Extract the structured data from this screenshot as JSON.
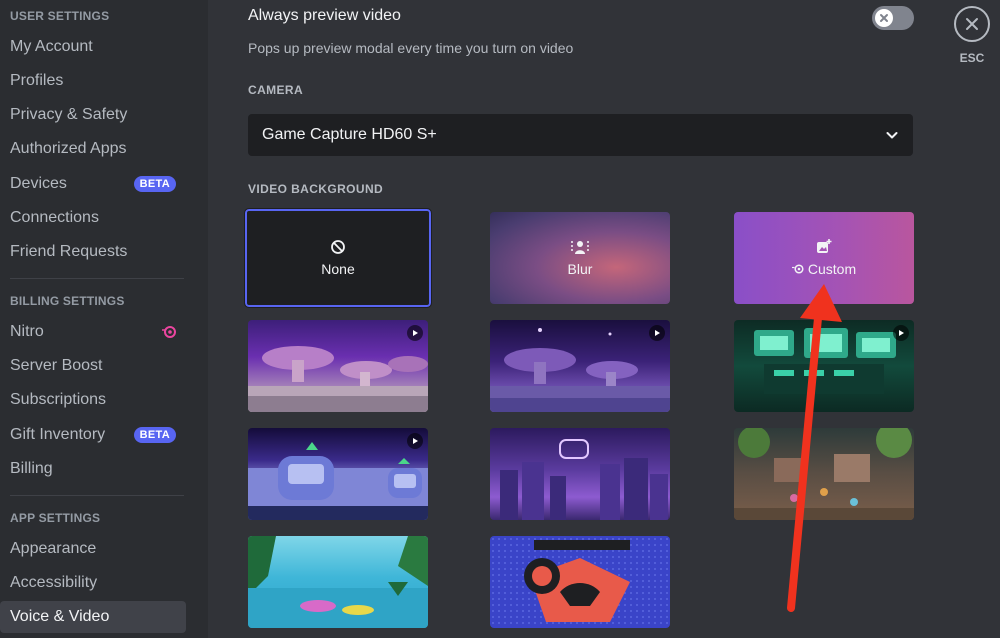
{
  "sidebar": {
    "user_settings_head": "User Settings",
    "user_items": [
      "My Account",
      "Profiles",
      "Privacy & Safety",
      "Authorized Apps",
      "Devices",
      "Connections",
      "Friend Requests"
    ],
    "devices_badge": "BETA",
    "billing_head": "Billing Settings",
    "billing_items": [
      "Nitro",
      "Server Boost",
      "Subscriptions",
      "Gift Inventory",
      "Billing"
    ],
    "gift_badge": "BETA",
    "app_head": "App Settings",
    "app_items": [
      "Appearance",
      "Accessibility",
      "Voice & Video"
    ],
    "active_item": "Voice & Video"
  },
  "preview": {
    "title": "Always preview video",
    "description": "Pops up preview modal every time you turn on video",
    "toggle_on": false
  },
  "camera": {
    "label": "Camera",
    "selected": "Game Capture HD60 S+"
  },
  "video_background": {
    "label": "Video Background",
    "none_label": "None",
    "blur_label": "Blur",
    "custom_label": "Custom",
    "selected": "None"
  },
  "esc_label": "ESC",
  "colors": {
    "accent": "#5865f2",
    "arrow": "#f0321e",
    "nitro": "#eb459f"
  }
}
